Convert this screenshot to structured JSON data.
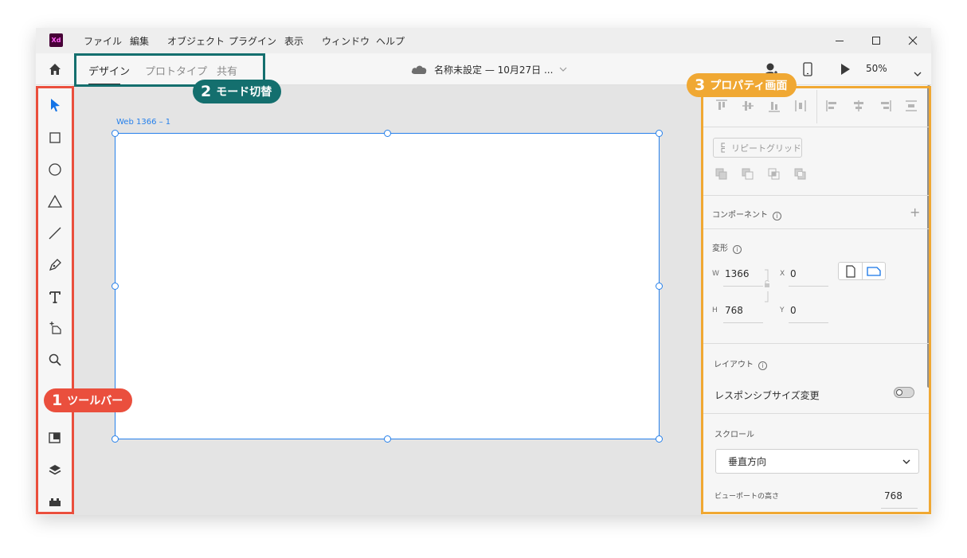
{
  "app": {
    "logo_text": "Xd"
  },
  "menubar": {
    "items": [
      "ファイル",
      "編集",
      "オブジェクト",
      "プラグイン",
      "表示",
      "ウィンドウ",
      "ヘルプ"
    ]
  },
  "mode_tabs": [
    "デザイン",
    "プロトタイプ",
    "共有"
  ],
  "document": {
    "title": "名称未設定 — 10月27日 ..."
  },
  "zoom": "50%",
  "tools": [
    "select-icon",
    "rectangle-icon",
    "ellipse-icon",
    "polygon-icon",
    "line-icon",
    "pen-icon",
    "text-icon",
    "artboard-icon",
    "zoom-icon",
    "assets-icon",
    "layers-icon",
    "plugins-icon"
  ],
  "artboard": {
    "label": "Web 1366 – 1"
  },
  "properties": {
    "repeat_grid": "リピートグリッド",
    "component": "コンポーネント",
    "transform": "変形",
    "w_label": "W",
    "w_value": "1366",
    "h_label": "H",
    "h_value": "768",
    "x_label": "X",
    "x_value": "0",
    "y_label": "Y",
    "y_value": "0",
    "layout": "レイアウト",
    "responsive": "レスポンシブサイズ変更",
    "scroll": "スクロール",
    "scroll_option": "垂直方向",
    "viewport_label": "ビューポートの高さ",
    "viewport_value": "768"
  },
  "annotations": [
    {
      "number": "1",
      "label": "ツールバー",
      "color": "#ea4f3d"
    },
    {
      "number": "2",
      "label": "モード切替",
      "color": "#146f6e"
    },
    {
      "number": "3",
      "label": "プロパティ画面",
      "color": "#f0a833"
    }
  ],
  "colors": {
    "selection_blue": "#2680eb",
    "xd_purple": "#470137",
    "xd_pink": "#ff61f6"
  }
}
